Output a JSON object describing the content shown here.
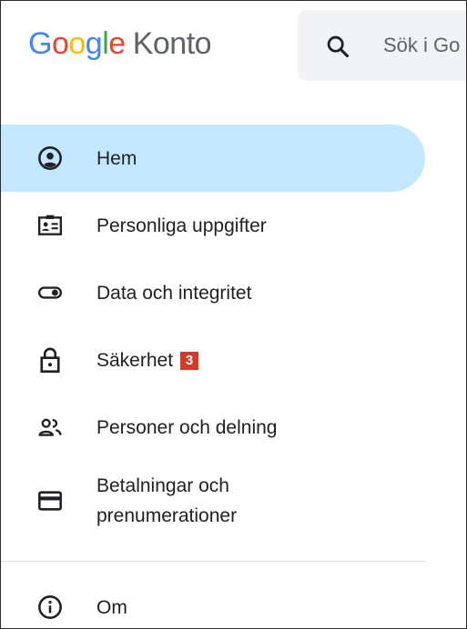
{
  "header": {
    "logo": {
      "letters": [
        "G",
        "o",
        "o",
        "g",
        "l",
        "e"
      ],
      "product": "Konto"
    },
    "search": {
      "placeholder": "Sök i Go",
      "icon": "search-icon"
    }
  },
  "nav": {
    "items": [
      {
        "label": "Hem",
        "icon": "account-circle-icon",
        "active": true
      },
      {
        "label": "Personliga uppgifter",
        "icon": "id-card-icon"
      },
      {
        "label": "Data och integritet",
        "icon": "toggle-icon"
      },
      {
        "label": "Säkerhet",
        "icon": "lock-icon",
        "badge": "3"
      },
      {
        "label": "Personer och delning",
        "icon": "people-icon"
      },
      {
        "label": "Betalningar och",
        "label_line2": "prenumerationer",
        "icon": "credit-card-icon"
      }
    ],
    "footer_item": {
      "label": "Om",
      "icon": "info-icon"
    }
  },
  "colors": {
    "active_bg": "#c2e7ff",
    "badge": "#d33a2c",
    "text": "#202124"
  }
}
